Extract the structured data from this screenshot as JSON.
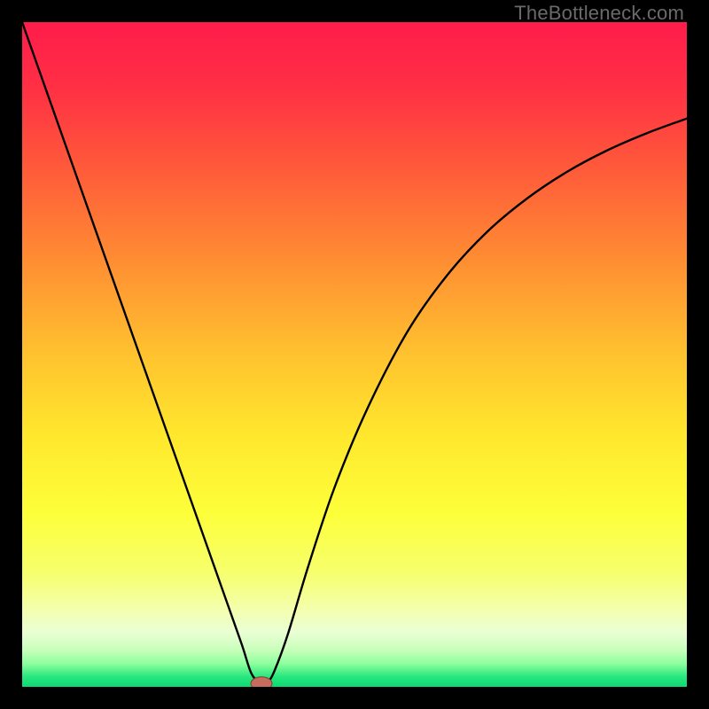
{
  "watermark": "TheBottleneck.com",
  "colors": {
    "bg": "#000000",
    "curve": "#000000",
    "marker_fill": "#c76b5f",
    "marker_stroke": "#7f3a33"
  },
  "chart_data": {
    "type": "line",
    "title": "",
    "xlabel": "",
    "ylabel": "",
    "xlim": [
      0,
      100
    ],
    "ylim": [
      0,
      100
    ],
    "gradient_stops": [
      {
        "offset": 0.0,
        "color": "#ff1c4b"
      },
      {
        "offset": 0.1,
        "color": "#ff3044"
      },
      {
        "offset": 0.22,
        "color": "#ff5a3a"
      },
      {
        "offset": 0.35,
        "color": "#ff8a33"
      },
      {
        "offset": 0.5,
        "color": "#ffc22f"
      },
      {
        "offset": 0.62,
        "color": "#ffe72d"
      },
      {
        "offset": 0.74,
        "color": "#fdff3a"
      },
      {
        "offset": 0.83,
        "color": "#f6ff6e"
      },
      {
        "offset": 0.885,
        "color": "#f4ffb0"
      },
      {
        "offset": 0.918,
        "color": "#eaffd4"
      },
      {
        "offset": 0.945,
        "color": "#c7ffba"
      },
      {
        "offset": 0.965,
        "color": "#8dff9d"
      },
      {
        "offset": 0.985,
        "color": "#27e77e"
      },
      {
        "offset": 1.0,
        "color": "#0fd873"
      }
    ],
    "series": [
      {
        "name": "bottleneck-curve",
        "x": [
          0,
          3,
          6,
          9,
          12,
          15,
          18,
          21,
          24,
          27,
          30,
          33,
          34.5,
          36,
          37,
          38,
          40,
          43,
          47,
          52,
          58,
          64,
          70,
          76,
          82,
          88,
          94,
          100
        ],
        "y": [
          100,
          91.5,
          83,
          74.5,
          66,
          57.5,
          49,
          40.5,
          32,
          23.5,
          15,
          6.5,
          2,
          0.5,
          0.8,
          2.5,
          8,
          18,
          30,
          42,
          53.5,
          62,
          68.5,
          73.5,
          77.5,
          80.7,
          83.3,
          85.5
        ]
      }
    ],
    "marker": {
      "x": 36,
      "y": 0.5,
      "rx": 1.6,
      "ry": 1.0
    }
  }
}
